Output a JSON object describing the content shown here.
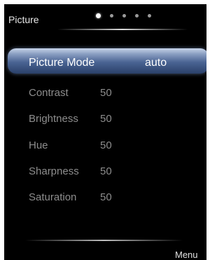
{
  "header": {
    "title": "Picture",
    "page_indicator": {
      "current": 1,
      "total": 5
    }
  },
  "picture_mode": {
    "label": "Picture Mode",
    "value": "auto"
  },
  "settings": [
    {
      "label": "Contrast",
      "value": "50"
    },
    {
      "label": "Brightness",
      "value": "50"
    },
    {
      "label": "Hue",
      "value": "50"
    },
    {
      "label": "Sharpness",
      "value": "50"
    },
    {
      "label": "Saturation",
      "value": "50"
    }
  ],
  "footer": {
    "menu_label": "Menu"
  }
}
